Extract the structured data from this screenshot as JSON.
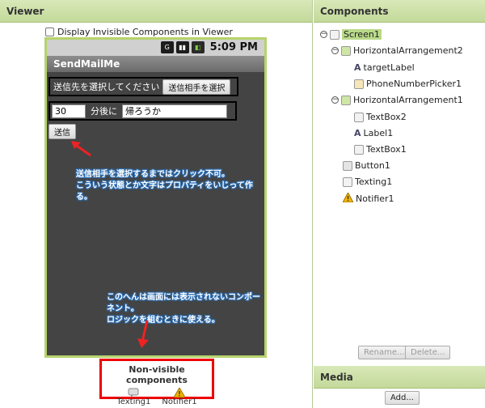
{
  "viewer": {
    "title": "Viewer",
    "display_invisible_label": "Display Invisible Components in Viewer"
  },
  "phone": {
    "status_time": "5:09 PM",
    "app_title": "SendMailMe",
    "row1_label": "送信先を選択してください",
    "row1_button": "送信相手を選択",
    "row2_textbox": "30",
    "row2_label": "分後に",
    "row2_textbox2": "帰ろうか",
    "send_button": "送信"
  },
  "annotations": {
    "note1_line1": "送信相手を選択するまではクリック不可。",
    "note1_line2": "こういう状態とか文字はプロパティをいじって作る。",
    "note2_line1": "このへんは画面には表示されないコンポーネント。",
    "note2_line2": "ロジックを組むときに使える。"
  },
  "nonvisible": {
    "title": "Non-visible components",
    "items": [
      {
        "label": "Texting1",
        "icon": "texting-icon"
      },
      {
        "label": "Notifier1",
        "icon": "warning-icon"
      }
    ]
  },
  "components": {
    "title": "Components",
    "tree": [
      {
        "label": "Screen1",
        "icon": "screen-icon"
      },
      {
        "label": "HorizontalArrangement2",
        "icon": "arrangement-icon"
      },
      {
        "label": "targetLabel",
        "icon": "label-icon"
      },
      {
        "label": "PhoneNumberPicker1",
        "icon": "picker-icon"
      },
      {
        "label": "HorizontalArrangement1",
        "icon": "arrangement-icon"
      },
      {
        "label": "TextBox2",
        "icon": "textbox-icon"
      },
      {
        "label": "Label1",
        "icon": "label-icon"
      },
      {
        "label": "TextBox1",
        "icon": "textbox-icon"
      },
      {
        "label": "Button1",
        "icon": "button-icon"
      },
      {
        "label": "Texting1",
        "icon": "texting-icon"
      },
      {
        "label": "Notifier1",
        "icon": "warning-icon"
      }
    ],
    "rename_button": "Rename...",
    "delete_button": "Delete..."
  },
  "media": {
    "title": "Media",
    "add_button": "Add..."
  }
}
